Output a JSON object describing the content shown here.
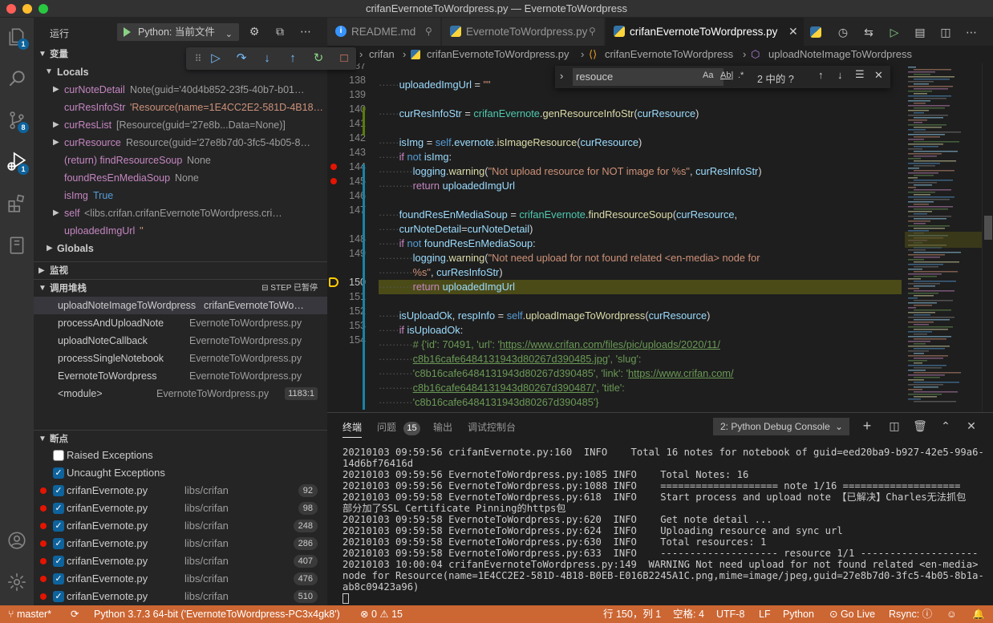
{
  "window": {
    "title": "crifanEvernoteToWordpress.py — EvernoteToWordpress"
  },
  "activity_bar": {
    "badges": {
      "explorer": "1",
      "scm": "8",
      "debug": "1"
    }
  },
  "sidebar": {
    "run_label": "运行",
    "run_config": "Python: 当前文件",
    "sections": {
      "variables": "变量",
      "watch": "监视",
      "callstack": "调用堆栈",
      "breakpoints": "断点"
    },
    "callstack_status": "STEP 已暂停",
    "scopes": {
      "locals": "Locals",
      "globals": "Globals"
    },
    "variables": [
      {
        "name": "curNoteDetail",
        "value": "Note(guid='40d4b852-23f5-40b7-b01…",
        "kind": "obj",
        "expandable": true
      },
      {
        "name": "curResInfoStr",
        "value": "'Resource(name=1E4CC2E2-581D-4B18…",
        "kind": "str",
        "expandable": false
      },
      {
        "name": "curResList",
        "value": "[Resource(guid='27e8b...Data=None)]",
        "kind": "obj",
        "expandable": true
      },
      {
        "name": "curResource",
        "value": "Resource(guid='27e8b7d0-3fc5-4b05-8…",
        "kind": "obj",
        "expandable": true
      },
      {
        "name": "(return) findResourceSoup",
        "value": "None",
        "kind": "obj",
        "expandable": false
      },
      {
        "name": "foundResEnMediaSoup",
        "value": "None",
        "kind": "obj",
        "expandable": false
      },
      {
        "name": "isImg",
        "value": "True",
        "kind": "bool",
        "expandable": false
      },
      {
        "name": "self",
        "value": "<libs.crifan.crifanEvernoteToWordpress.cri…",
        "kind": "obj",
        "expandable": true
      },
      {
        "name": "uploadedImgUrl",
        "value": "''",
        "kind": "str",
        "expandable": false
      }
    ],
    "callstack": [
      {
        "fn": "uploadNoteImageToWordpress",
        "file": "crifanEvernoteToWo…"
      },
      {
        "fn": "processAndUploadNote",
        "file": "EvernoteToWordpress.py"
      },
      {
        "fn": "uploadNoteCallback",
        "file": "EvernoteToWordpress.py"
      },
      {
        "fn": "processSingleNotebook",
        "file": "EvernoteToWordpress.py"
      },
      {
        "fn": "EvernoteToWordpress",
        "file": "EvernoteToWordpress.py"
      },
      {
        "fn": "<module>",
        "file": "EvernoteToWordpress.py",
        "line": "1183:1"
      }
    ],
    "exceptions": [
      {
        "label": "Raised Exceptions",
        "checked": false
      },
      {
        "label": "Uncaught Exceptions",
        "checked": true
      }
    ],
    "breakpoints": [
      {
        "file": "crifanEvernote.py",
        "path": "libs/crifan",
        "line": "92"
      },
      {
        "file": "crifanEvernote.py",
        "path": "libs/crifan",
        "line": "98"
      },
      {
        "file": "crifanEvernote.py",
        "path": "libs/crifan",
        "line": "248"
      },
      {
        "file": "crifanEvernote.py",
        "path": "libs/crifan",
        "line": "286"
      },
      {
        "file": "crifanEvernote.py",
        "path": "libs/crifan",
        "line": "407"
      },
      {
        "file": "crifanEvernote.py",
        "path": "libs/crifan",
        "line": "476"
      },
      {
        "file": "crifanEvernote.py",
        "path": "libs/crifan",
        "line": "510"
      }
    ]
  },
  "tabs": [
    {
      "label": "README.md",
      "active": false
    },
    {
      "label": "EvernoteToWordpress.py",
      "active": false
    },
    {
      "label": "crifanEvernoteToWordpress.py",
      "active": true
    }
  ],
  "breadcrumb": {
    "folder": "crifan",
    "file": "crifanEvernoteToWordpress.py",
    "cls": "crifanEvernoteToWordpress",
    "method": "uploadNoteImageToWordpress"
  },
  "find": {
    "query": "resouce",
    "count": "2 中的 ?",
    "opt_case": "Aa",
    "opt_word": "Ab|",
    "opt_regex": ".*"
  },
  "editor": {
    "line_numbers": [
      "137",
      "138",
      "139",
      "140",
      "141",
      "142",
      "143",
      "144",
      "145",
      "146",
      "147",
      "",
      "148",
      "149",
      "",
      "150",
      "151",
      "152",
      "153",
      "154",
      "",
      "",
      "",
      "",
      ""
    ],
    "current_line": "150",
    "breakpoint_lines": [
      "144",
      "145"
    ]
  },
  "panel": {
    "tabs": {
      "terminal": "终端",
      "problems": "问题",
      "output": "输出",
      "debug_console": "调试控制台"
    },
    "problems_count": "15",
    "terminal_select": "2: Python Debug Console",
    "terminal_lines": [
      "20210103 09:59:56 crifanEvernote.py:160  INFO    Total 16 notes for notebook of guid=eed20ba9-b927-42e5-99a6-",
      "14d6bf76416d",
      "20210103 09:59:56 EvernoteToWordpress.py:1085 INFO    Total Notes: 16",
      "20210103 09:59:56 EvernoteToWordpress.py:1088 INFO    ==================== note 1/16 ====================",
      "20210103 09:59:58 EvernoteToWordpress.py:618  INFO    Start process and upload note 【已解决】Charles无法抓包",
      "部分加了SSL Certificate Pinning的https包",
      "20210103 09:59:58 EvernoteToWordpress.py:620  INFO    Get note detail ...",
      "20210103 09:59:58 EvernoteToWordpress.py:624  INFO    Uploading resource and sync url",
      "20210103 09:59:58 EvernoteToWordpress.py:630  INFO    Total resources: 1",
      "20210103 09:59:58 EvernoteToWordpress.py:633  INFO    -------------------- resource 1/1 --------------------",
      "20210103 10:00:04 crifanEvernoteToWordpress.py:149  WARNING Not need upload for not found related <en-media>",
      "node for Resource(name=1E4CC2E2-581D-4B18-B0EB-E016B2245A1C.png,mime=image/jpeg,guid=27e8b7d0-3fc5-4b05-8b1a-",
      "ab8c09423a96)"
    ]
  },
  "statusbar": {
    "branch": "master*",
    "interpreter": "Python 3.7.3 64-bit ('EvernoteToWordpress-PC3x4gk8')",
    "errors": "0",
    "warnings": "15",
    "position": "行 150，列 1",
    "spaces": "空格: 4",
    "encoding": "UTF-8",
    "eol": "LF",
    "language": "Python",
    "golive": "Go Live",
    "rsync": "Rsync:"
  },
  "colors": {
    "accent": "#0e639c",
    "statusbar": "#cc6633",
    "breakpoint": "#e51400",
    "current_line": "#4b4b18"
  }
}
